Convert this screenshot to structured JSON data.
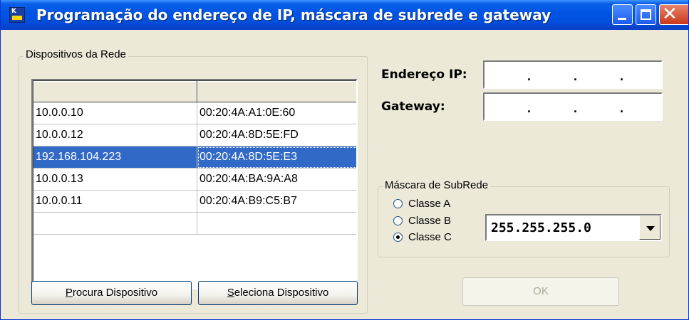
{
  "window": {
    "title": "Programação do endereço de IP, máscara de subrede e gateway"
  },
  "devices": {
    "legend": "Dispositivos da Rede",
    "rows": [
      {
        "ip": "10.0.0.10",
        "mac": "00:20:4A:A1:0E:60"
      },
      {
        "ip": "10.0.0.12",
        "mac": "00:20:4A:8D:5E:FD"
      },
      {
        "ip": "192.168.104.223",
        "mac": "00:20:4A:8D:5E:E3"
      },
      {
        "ip": "10.0.0.13",
        "mac": "00:20:4A:BA:9A:A8"
      },
      {
        "ip": "10.0.0.11",
        "mac": "00:20:4A:B9:C5:B7"
      },
      {
        "ip": "",
        "mac": ""
      }
    ],
    "selected_row": 2,
    "search_button_key": "P",
    "search_button_rest": "rocura Dispositivo",
    "select_button_key": "S",
    "select_button_rest": "eleciona Dispositivo"
  },
  "network": {
    "ip_label": "Endereço IP:",
    "gateway_label": "Gateway:",
    "ip_value": ".   .   .",
    "gateway_value": ".   .   ."
  },
  "subnet": {
    "legend": "Máscara de SubRede",
    "options": [
      "Classe A",
      "Classe B",
      "Classe C"
    ],
    "selected": "Classe C",
    "mask_value": "255.255.255.0"
  },
  "ok_label": "OK"
}
